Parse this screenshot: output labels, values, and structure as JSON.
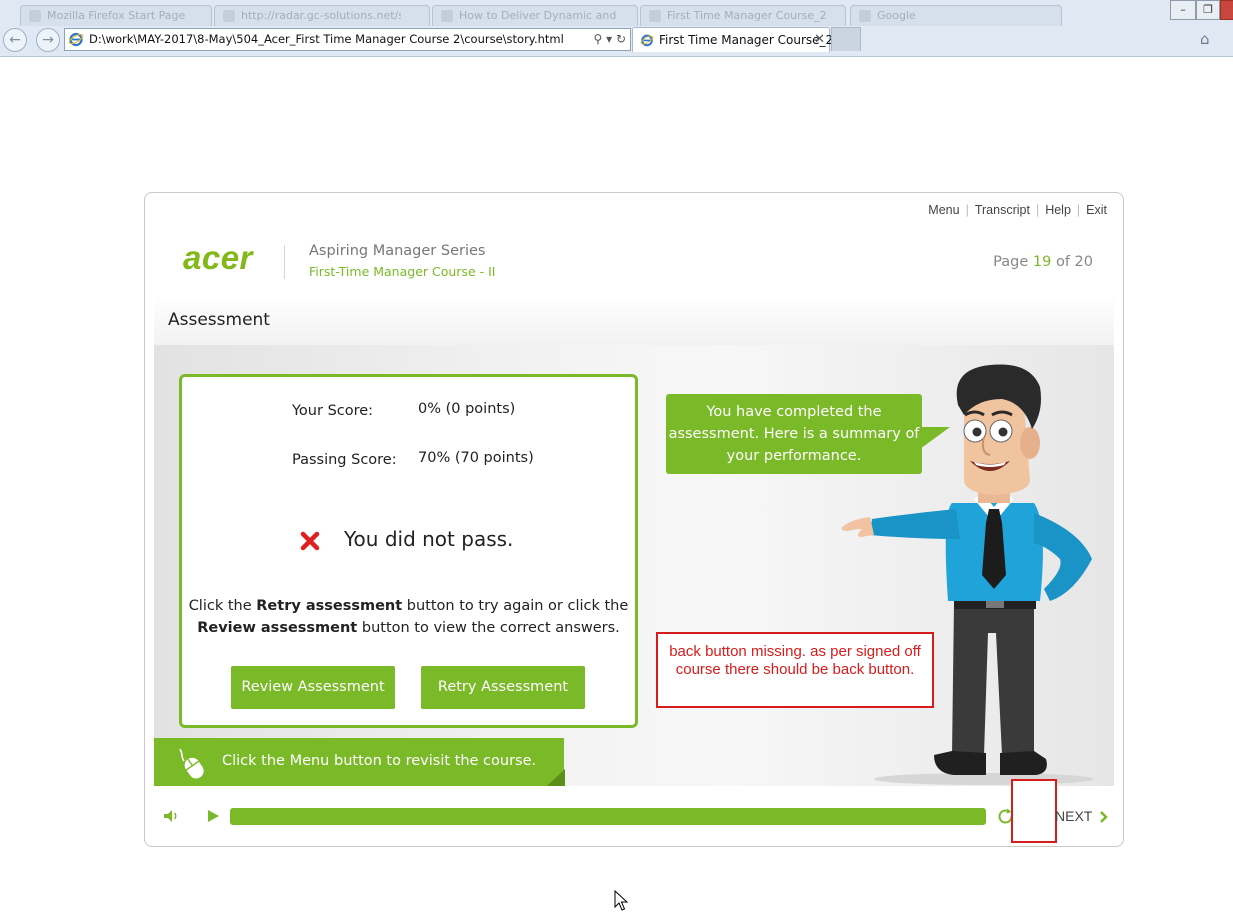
{
  "browser": {
    "background_tabs": [
      {
        "label": "Mozilla Firefox Start Page"
      },
      {
        "label": "http://radar.gc-solutions.net/spi"
      },
      {
        "label": "How to Deliver Dynamic and Pro"
      },
      {
        "label": "First Time Manager Course_2"
      },
      {
        "label": "Google"
      }
    ],
    "address": "D:\\work\\MAY-2017\\8-May\\504_Acer_First Time Manager Course 2\\course\\story.html",
    "active_tab": {
      "label": "First Time Manager Course_2",
      "close": "✕"
    },
    "window_controls": {
      "minimize": "–",
      "restore": "❐",
      "close": "✕"
    }
  },
  "player": {
    "nav": [
      {
        "label": "Menu"
      },
      {
        "label": "Transcript"
      },
      {
        "label": "Help"
      },
      {
        "label": "Exit"
      }
    ],
    "nav_separator": "|",
    "logo": "acer",
    "series": "Aspiring Manager Series",
    "course": "First-Time Manager Course - II",
    "page": {
      "prefix": "Page",
      "current": "19",
      "of": "of",
      "total": "20"
    },
    "slide_title": "Assessment"
  },
  "results": {
    "score_label": "Your Score:",
    "score_value": "0% (0 points)",
    "passing_label": "Passing Score:",
    "passing_value": "70% (70 points)",
    "status": "You did not pass.",
    "instruction": {
      "p1": "Click the ",
      "b1": "Retry assessment",
      "p2": " button to try again or click the ",
      "b2": "Review assessment",
      "p3": " button to view the correct answers."
    },
    "review_button": "Review Assessment",
    "retry_button": "Retry Assessment"
  },
  "speech_bubble": "You have completed the assessment. Here is a summary of your performance.",
  "annotation": "back button missing. as per signed off course there should be back button.",
  "hint": "Click the Menu button to revisit the course.",
  "controls": {
    "next_label": "NEXT",
    "progress": 1.0
  },
  "colors": {
    "brand_green": "#7ab927",
    "annotation_red": "#d61c1c"
  },
  "icons": [
    "back-icon",
    "forward-icon",
    "ie-icon",
    "search-icon",
    "refresh-icon",
    "home-icon",
    "fail-x-icon",
    "mouse-icon",
    "volume-icon",
    "play-icon",
    "replay-icon",
    "chevron-right-icon"
  ]
}
